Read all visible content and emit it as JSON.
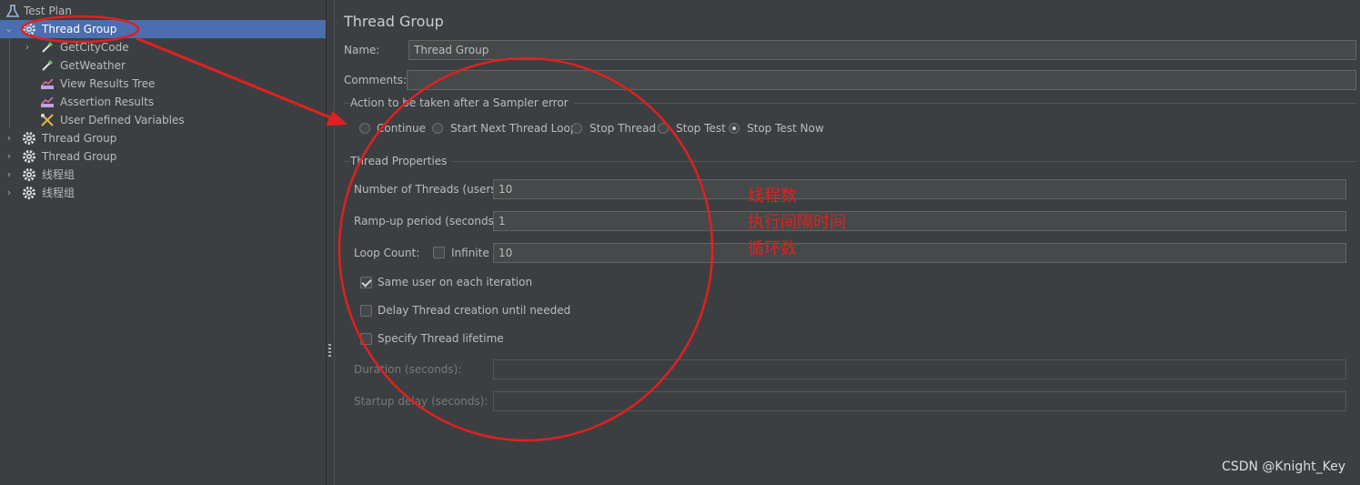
{
  "tree": {
    "items": [
      {
        "label": "Test Plan",
        "icon": "test-plan-icon"
      },
      {
        "label": "Thread Group",
        "icon": "gear-icon"
      },
      {
        "label": "GetCityCode",
        "icon": "sampler-pipette-icon"
      },
      {
        "label": "GetWeather",
        "icon": "sampler-pipette-icon"
      },
      {
        "label": "View Results Tree",
        "icon": "listener-chart-icon"
      },
      {
        "label": "Assertion Results",
        "icon": "listener-chart-icon"
      },
      {
        "label": "User Defined Variables",
        "icon": "config-wrench-icon"
      },
      {
        "label": "Thread Group",
        "icon": "gear-icon"
      },
      {
        "label": "Thread Group",
        "icon": "gear-icon"
      },
      {
        "label": "线程组",
        "icon": "gear-icon"
      },
      {
        "label": "线程组",
        "icon": "gear-icon"
      }
    ]
  },
  "panel": {
    "title": "Thread Group",
    "name_label": "Name:",
    "name_value": "Thread Group",
    "comments_label": "Comments:",
    "comments_value": "",
    "sampler_error": {
      "title": "Action to be taken after a Sampler error",
      "options": [
        "Continue",
        "Start Next Thread Loop",
        "Stop Thread",
        "Stop Test",
        "Stop Test Now"
      ],
      "selected": "Stop Test Now"
    },
    "thread_props": {
      "title": "Thread Properties",
      "threads_label": "Number of Threads (users):",
      "threads_value": "10",
      "rampup_label": "Ramp-up period (seconds):",
      "rampup_value": "1",
      "loop_label": "Loop Count:",
      "infinite_label": "Infinite",
      "infinite_checked": false,
      "loop_value": "10",
      "same_user_label": "Same user on each iteration",
      "same_user_checked": true,
      "delay_label": "Delay Thread creation until needed",
      "delay_checked": false,
      "lifetime_label": "Specify Thread lifetime",
      "lifetime_checked": false,
      "duration_label": "Duration (seconds):",
      "duration_value": "",
      "startup_label": "Startup delay (seconds):",
      "startup_value": ""
    }
  },
  "annotations": {
    "color": "#e02020",
    "threads_note": "线程数",
    "rampup_note": "执行间隔时间",
    "loop_note": "循环数"
  },
  "watermark": "CSDN @Knight_Key",
  "colors": {
    "background": "#3c3f41",
    "selection": "#4b6eaf",
    "field": "#45494a",
    "annotation": "#e02020"
  }
}
